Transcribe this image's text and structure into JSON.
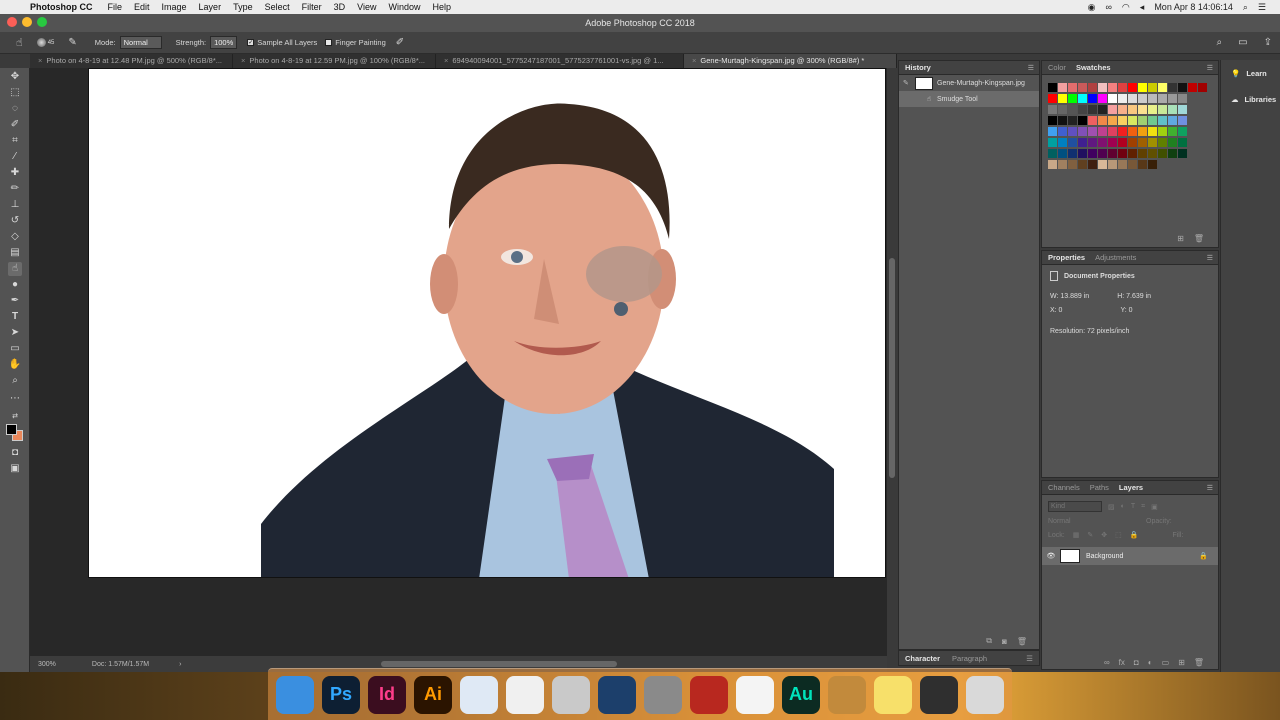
{
  "menubar": {
    "app": "Photoshop CC",
    "items": [
      "File",
      "Edit",
      "Image",
      "Layer",
      "Type",
      "Select",
      "Filter",
      "3D",
      "View",
      "Window",
      "Help"
    ],
    "clock": "Mon Apr 8  14:06:14"
  },
  "window": {
    "title": "Adobe Photoshop CC 2018"
  },
  "options": {
    "brush_size": "45",
    "mode_label": "Mode:",
    "mode_value": "Normal",
    "strength_label": "Strength:",
    "strength_value": "100%",
    "sample_all_layers": "Sample All Layers",
    "finger_painting": "Finger Painting"
  },
  "tabs": [
    {
      "label": "Photo on 4-8-19 at 12.48 PM.jpg @ 500% (RGB/8*..."
    },
    {
      "label": "Photo on 4-8-19 at 12.59 PM.jpg @ 100% (RGB/8*..."
    },
    {
      "label": "694940094001_5775247187001_5775237761001-vs.jpg @ 1..."
    },
    {
      "label": "Gene-Murtagh-Kingspan.jpg @ 300% (RGB/8#) *"
    }
  ],
  "status": {
    "zoom": "300%",
    "doc": "Doc: 1.57M/1.57M"
  },
  "history": {
    "title": "History",
    "snapshot": "Gene-Murtagh-Kingspan.jpg",
    "step": "Smudge Tool"
  },
  "color_panel": {
    "tab_color": "Color",
    "tab_swatches": "Swatches"
  },
  "properties": {
    "tab_properties": "Properties",
    "tab_adjustments": "Adjustments",
    "header": "Document Properties",
    "w": "W:  13.889 in",
    "h": "H:  7.639 in",
    "x": "X:  0",
    "y": "Y:  0",
    "resolution": "Resolution: 72 pixels/inch"
  },
  "layers": {
    "tab_channels": "Channels",
    "tab_paths": "Paths",
    "tab_layers": "Layers",
    "kind": "Kind",
    "blend": "Normal",
    "opacity": "Opacity:",
    "lock": "Lock:",
    "fill": "Fill:",
    "layer_name": "Background"
  },
  "bottom_tabs": {
    "character": "Character",
    "paragraph": "Paragraph"
  },
  "rightcol": {
    "learn": "Learn",
    "libraries": "Libraries"
  },
  "dock": [
    {
      "name": "finder",
      "label": "",
      "bg": "#3a8fe0",
      "fg": "#ffffff"
    },
    {
      "name": "photoshop",
      "label": "Ps",
      "bg": "#0d1f33",
      "fg": "#31a8ff"
    },
    {
      "name": "indesign",
      "label": "Id",
      "bg": "#3b0d1f",
      "fg": "#ff3d8b"
    },
    {
      "name": "illustrator",
      "label": "Ai",
      "bg": "#2b1400",
      "fg": "#ff9a00"
    },
    {
      "name": "safari",
      "label": "",
      "bg": "#dfe9f5",
      "fg": "#1e6fd9"
    },
    {
      "name": "keynote",
      "label": "",
      "bg": "#f0f0f0",
      "fg": "#2a74c9"
    },
    {
      "name": "airdrop",
      "label": "",
      "bg": "#c9c9c9",
      "fg": "#666666"
    },
    {
      "name": "quicktime",
      "label": "",
      "bg": "#1c3f6b",
      "fg": "#9fd4ff"
    },
    {
      "name": "system-preferences",
      "label": "",
      "bg": "#8a8a8a",
      "fg": "#333333"
    },
    {
      "name": "photo-booth",
      "label": "",
      "bg": "#b8281f",
      "fg": "#ffffff"
    },
    {
      "name": "chrome",
      "label": "",
      "bg": "#f4f4f4",
      "fg": "#db4437"
    },
    {
      "name": "audition",
      "label": "Au",
      "bg": "#0c2b22",
      "fg": "#00e4bb"
    },
    {
      "name": "garageband",
      "label": "",
      "bg": "#c28a3c",
      "fg": "#3a2200"
    },
    {
      "name": "notes",
      "label": "",
      "bg": "#f7e06a",
      "fg": "#8a6a00"
    },
    {
      "name": "photos-browser",
      "label": "",
      "bg": "#2f2f2f",
      "fg": "#cfcfcf"
    },
    {
      "name": "trash",
      "label": "",
      "bg": "#d9d9d9",
      "fg": "#777777"
    }
  ]
}
